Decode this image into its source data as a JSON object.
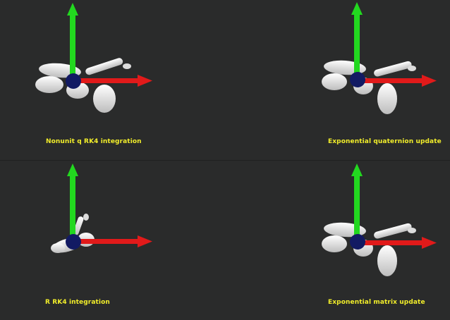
{
  "panels": [
    {
      "id": "tl",
      "caption": "Nonunit q RK4 integration"
    },
    {
      "id": "tr",
      "caption": "Exponential quaternion update"
    },
    {
      "id": "bl",
      "caption": "R RK4 integration"
    },
    {
      "id": "br",
      "caption": "Exponential matrix update"
    }
  ],
  "colors": {
    "background": "#2a2b2b",
    "caption": "#f2ee2a",
    "x_axis": "#e11a1a",
    "y_axis": "#22d81f",
    "center": "#121a63",
    "model": "#e9e9e9"
  }
}
